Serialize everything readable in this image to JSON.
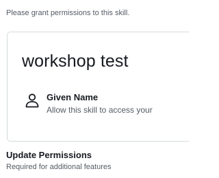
{
  "intro_text": "Please grant permissions to this skill.",
  "skill_card": {
    "skill_name": "workshop test",
    "permission": {
      "icon": "person-icon",
      "title": "Given Name",
      "description": "Allow this skill to access your"
    }
  },
  "update_permissions": {
    "title": "Update Permissions",
    "subtitle": "Required for additional features"
  },
  "colors": {
    "text_primary": "#16191f",
    "text_secondary": "#545b64",
    "card_border": "#d5dbdb"
  }
}
